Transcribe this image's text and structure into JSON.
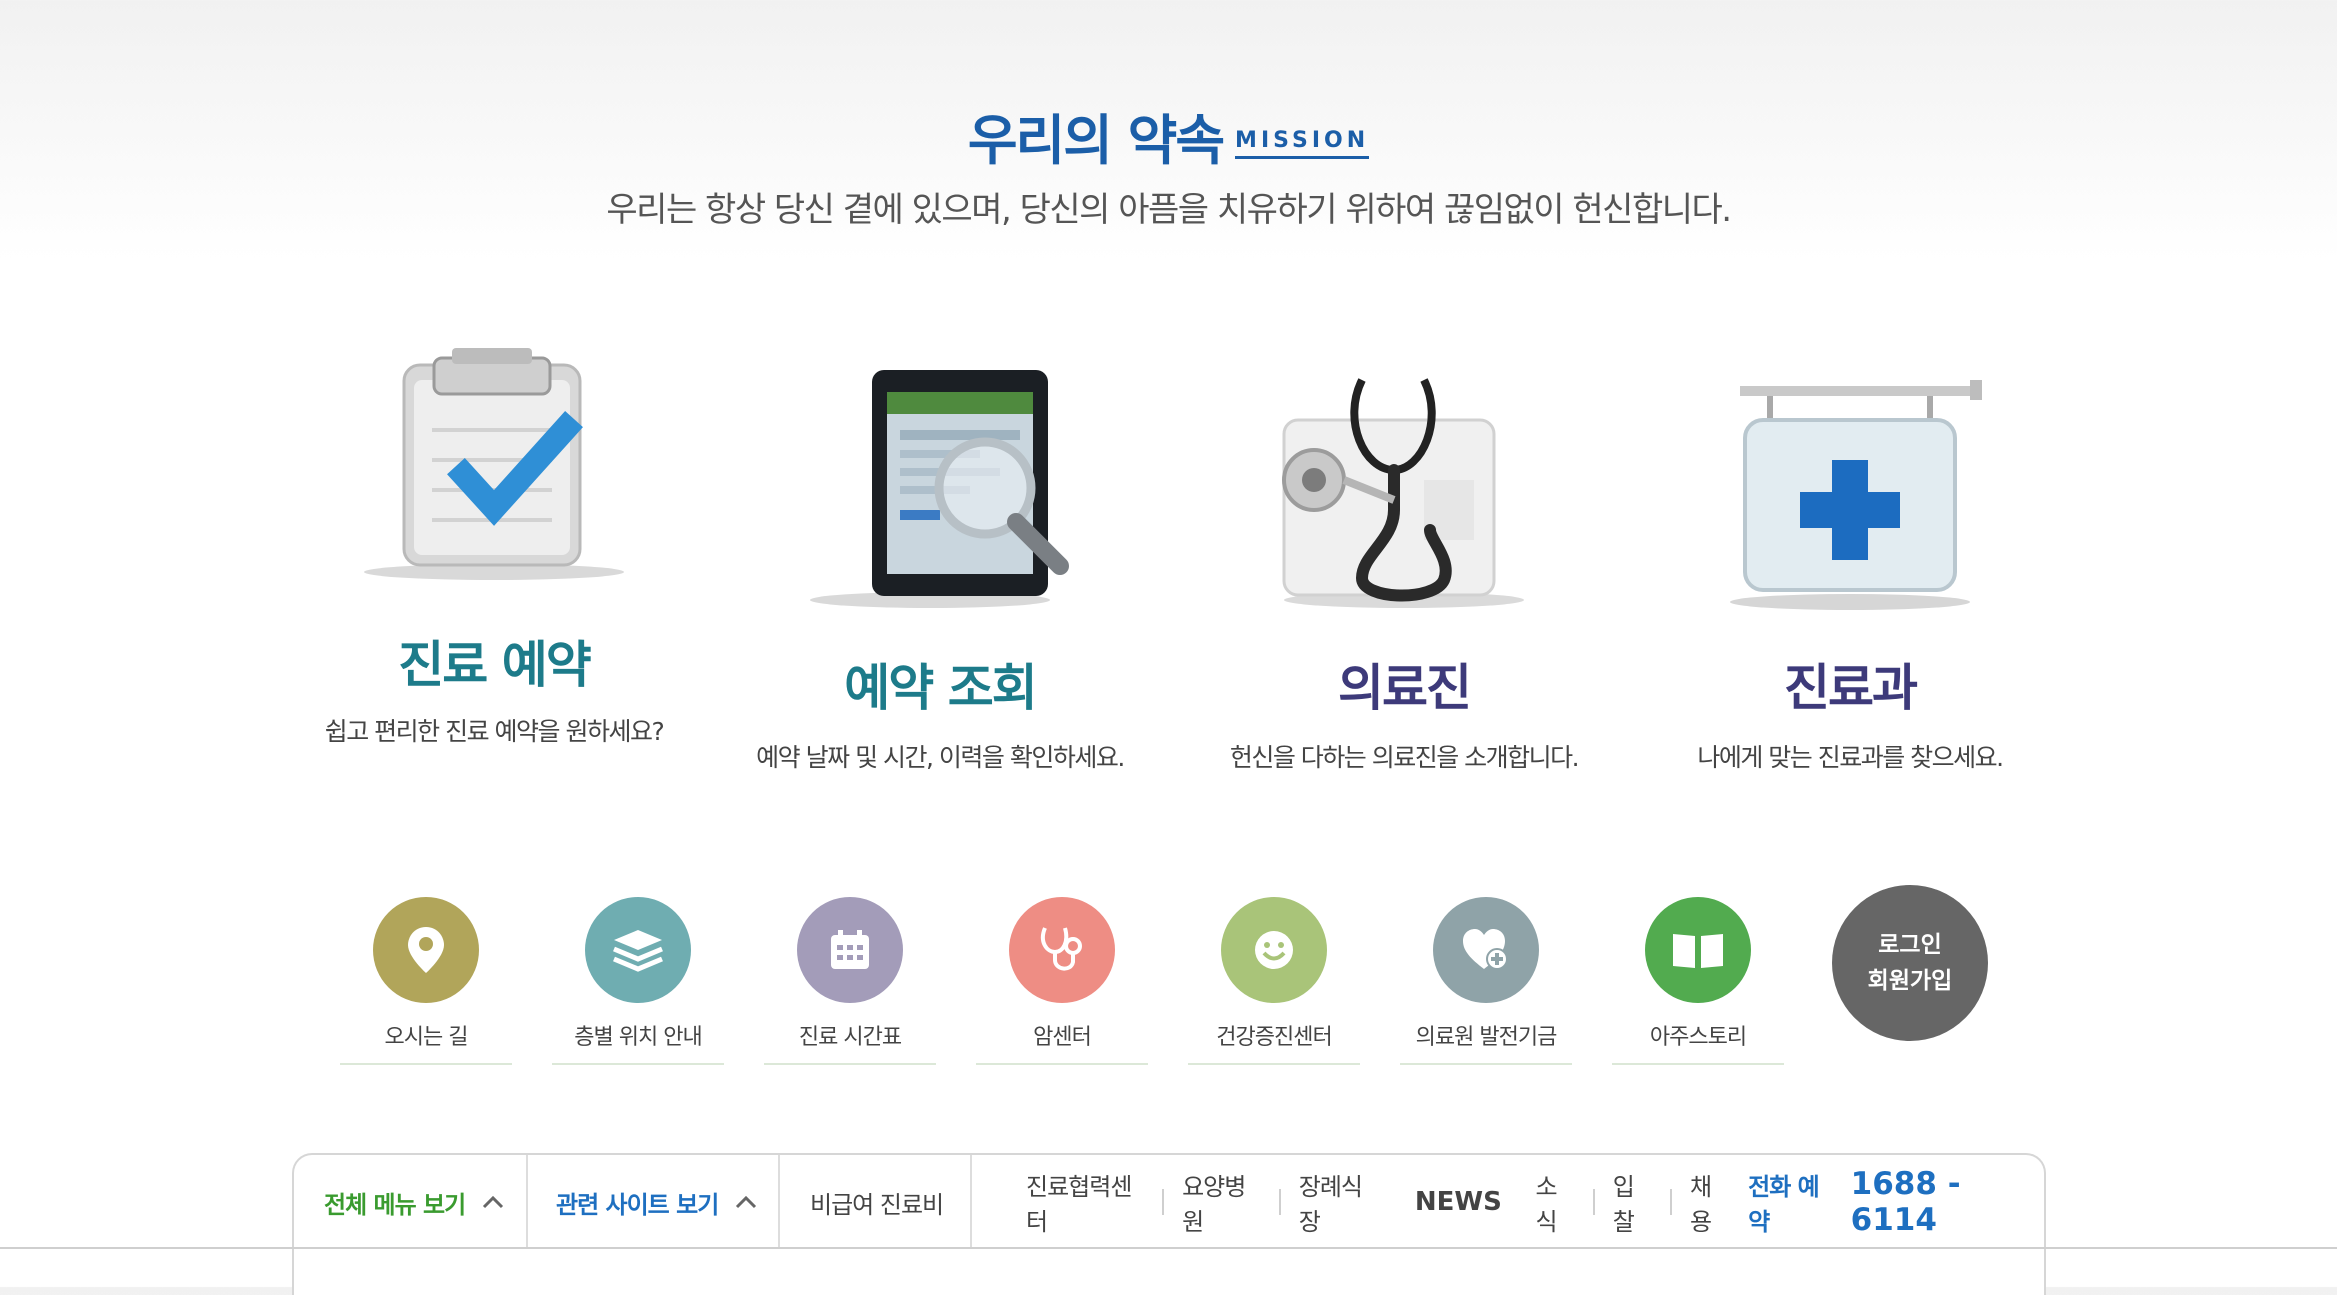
{
  "mission": {
    "title": "우리의 약속",
    "subtitle_en": "MISSION",
    "description": "우리는 항상 당신 곁에 있으며, 당신의 아픔을 치유하기 위하여 끊임없이 헌신합니다."
  },
  "features": [
    {
      "title": "진료 예약",
      "desc": "쉽고 편리한 진료 예약을 원하세요?",
      "color": "#1d7b8a"
    },
    {
      "title": "예약 조회",
      "desc": "예약 날짜 및 시간, 이력을 확인하세요.",
      "color": "#1d7b8a"
    },
    {
      "title": "의료진",
      "desc": "헌신을 다하는 의료진을 소개합니다.",
      "color": "#3d3a7a"
    },
    {
      "title": "진료과",
      "desc": "나에게 맞는 진료과를 찾으세요.",
      "color": "#3d3a7a"
    }
  ],
  "quick_links": [
    {
      "label": "오시는 길",
      "icon": "location-pin-icon",
      "color": "#b1a55a"
    },
    {
      "label": "층별 위치 안내",
      "icon": "layers-icon",
      "color": "#6fadb1"
    },
    {
      "label": "진료 시간표",
      "icon": "calendar-icon",
      "color": "#a39cb9"
    },
    {
      "label": "암센터",
      "icon": "stethoscope-icon",
      "color": "#ee8d84"
    },
    {
      "label": "건강증진센터",
      "icon": "smile-icon",
      "color": "#a9c479"
    },
    {
      "label": "의료원 발전기금",
      "icon": "heart-plus-icon",
      "color": "#8fa3a8"
    },
    {
      "label": "아주스토리",
      "icon": "book-icon",
      "color": "#52ab4f"
    }
  ],
  "login": {
    "line1": "로그인",
    "line2": "회원가입",
    "color": "#666666"
  },
  "bottom_bar": {
    "all_menu": "전체 메뉴 보기",
    "related_sites": "관련 사이트 보기",
    "non_covered": "비급여 진료비",
    "links": [
      "진료협력센터",
      "요양병원",
      "장례식장"
    ],
    "news": "NEWS",
    "news_links": [
      "소식",
      "입찰",
      "채용"
    ],
    "phone_label": "전화 예약",
    "phone_number": "1688 - 6114",
    "accent_green": "#3a9b2f",
    "accent_blue": "#1e6fc0"
  }
}
